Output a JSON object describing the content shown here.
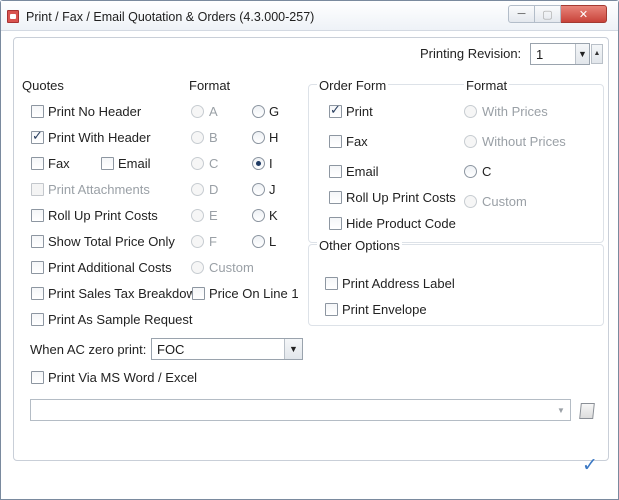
{
  "window": {
    "title": "Print / Fax / Email Quotation & Orders (4.3.000-257)",
    "min_symbol": "─",
    "max_symbol": "▢",
    "close_symbol": "✕"
  },
  "revision": {
    "label": "Printing Revision:",
    "value": "1"
  },
  "quotes": {
    "heading": "Quotes",
    "items": {
      "no_header": "Print No Header",
      "with_header": "Print With Header",
      "fax": "Fax",
      "email": "Email",
      "attachments": "Print Attachments",
      "roll_up": "Roll Up Print Costs",
      "total_price": "Show Total Price Only",
      "additional_costs": "Print Additional Costs",
      "sales_tax": "Print Sales Tax Breakdow",
      "price_on_line": "Price On Line 1",
      "sample_request": "Print As Sample Request"
    }
  },
  "quote_format": {
    "heading": "Format",
    "left": [
      "A",
      "B",
      "C",
      "D",
      "E",
      "F"
    ],
    "right": [
      "G",
      "H",
      "I",
      "J",
      "K",
      "L"
    ],
    "custom": "Custom",
    "selected": "I"
  },
  "ac_zero": {
    "label": "When AC zero print:",
    "value": "FOC"
  },
  "ms_word": "Print Via MS Word / Excel",
  "order_form": {
    "heading": "Order Form",
    "print": "Print",
    "fax": "Fax",
    "email": "Email",
    "roll_up": "Roll Up Print Costs",
    "hide_code": "Hide Product Code"
  },
  "order_format": {
    "heading": "Format",
    "with_prices": "With Prices",
    "without_prices": "Without Prices",
    "c": "C",
    "custom": "Custom"
  },
  "other_options": {
    "heading": "Other Options",
    "address_label": "Print Address Label",
    "envelope": "Print Envelope"
  },
  "path_value": "",
  "icons": {
    "ok": "checkmark-icon",
    "browse": "document-icon",
    "dropdown": "chevron-down-icon"
  }
}
